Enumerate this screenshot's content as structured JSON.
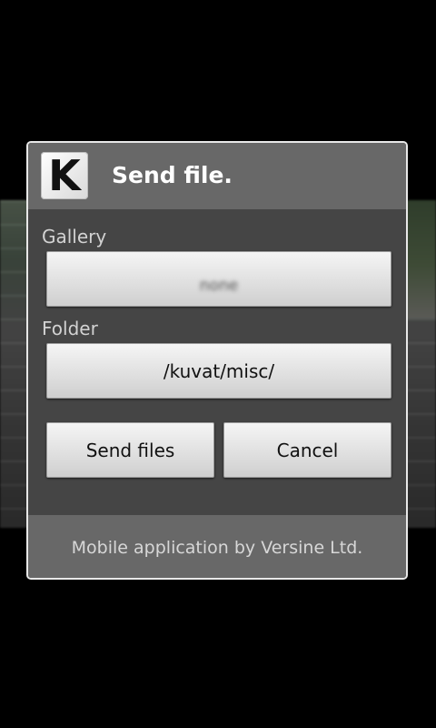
{
  "dialog": {
    "title": "Send file.",
    "logo_letter": "K"
  },
  "gallery": {
    "label": "Gallery",
    "value": "none"
  },
  "folder": {
    "label": "Folder",
    "value": "/kuvat/misc/"
  },
  "actions": {
    "send_label": "Send files",
    "cancel_label": "Cancel"
  },
  "footer": {
    "text": "Mobile application by Versine Ltd."
  },
  "colors": {
    "header_bg": "#686868",
    "body_bg": "#454545",
    "border": "#e8e8e8"
  }
}
